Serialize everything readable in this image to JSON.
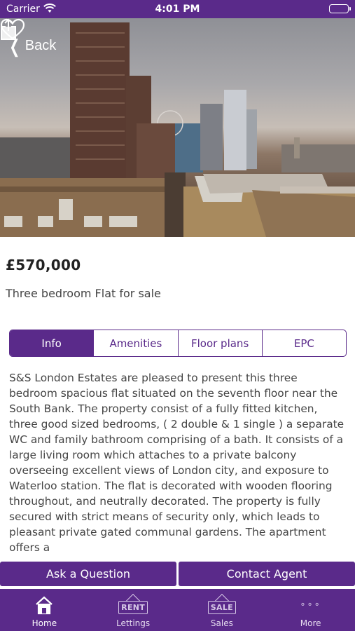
{
  "status_bar": {
    "carrier": "Carrier",
    "time": "4:01 PM",
    "wifi_icon": "wifi-icon",
    "battery_icon": "battery-icon"
  },
  "nav": {
    "back_label": "Back",
    "share_icon": "share-icon",
    "favourite_icon": "heart-icon"
  },
  "listing": {
    "price": "£570,000",
    "subtitle": "Three bedroom Flat for sale"
  },
  "tabs": [
    {
      "label": "Info",
      "active": true
    },
    {
      "label": "Amenities",
      "active": false
    },
    {
      "label": "Floor plans",
      "active": false
    },
    {
      "label": "EPC",
      "active": false
    }
  ],
  "description": "S&S London Estates are pleased to present this three bedroom spacious flat situated on the seventh floor near the South Bank. The property consist of a fully fitted kitchen, three good sized bedrooms, ( 2 double & 1 single ) a separate WC and family bathroom comprising of a bath. It consists of  a large living room which attaches to a private  balcony overseeing excellent views of London city, and exposure to Waterloo station. The flat is decorated with wooden flooring throughout, and neutrally decorated. The property is fully secured with strict means of security only, which leads to pleasant private gated communal gardens. The apartment offers a",
  "actions": {
    "ask_label": "Ask a Question",
    "contact_label": "Contact Agent"
  },
  "tab_bar": [
    {
      "label": "Home",
      "icon": "home-icon",
      "selected": true
    },
    {
      "label": "Lettings",
      "icon": "rent-sign-icon",
      "icon_text": "RENT",
      "selected": false
    },
    {
      "label": "Sales",
      "icon": "sale-sign-icon",
      "icon_text": "SALE",
      "selected": false
    },
    {
      "label": "More",
      "icon": "more-icon",
      "icon_text": "∘∘∘",
      "selected": false
    }
  ],
  "colors": {
    "brand": "#5a2a8a",
    "text": "#444444"
  }
}
